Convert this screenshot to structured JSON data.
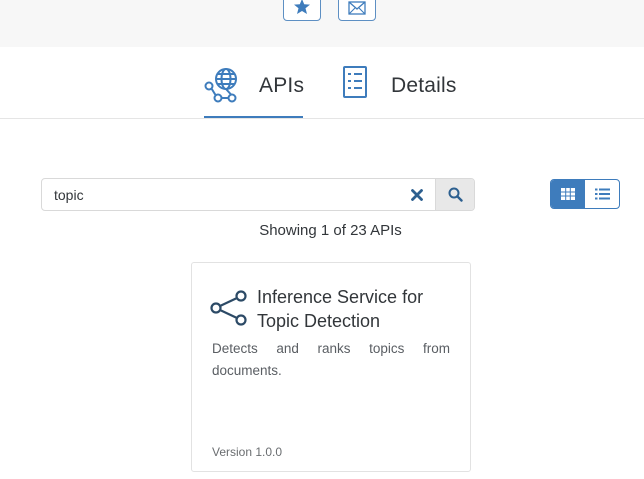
{
  "top_bar": {
    "favorite_icon": "star-icon",
    "mail_icon": "envelope-icon"
  },
  "tabs": [
    {
      "label": "APIs",
      "icon": "globe-network-icon",
      "active": true
    },
    {
      "label": "Details",
      "icon": "document-list-icon",
      "active": false
    }
  ],
  "search": {
    "value": "topic",
    "placeholder": "",
    "clear_icon": "close-icon",
    "search_icon": "search-icon"
  },
  "view_toggle": {
    "options": [
      "grid-view-icon",
      "list-view-icon"
    ],
    "active": "grid-view-icon"
  },
  "results": {
    "summary": "Showing 1 of 23 APIs"
  },
  "cards": [
    {
      "icon": "share-icon",
      "title": "Inference Service for Topic Detection",
      "description": "Detects and ranks topics from documents.",
      "version": "Version 1.0.0"
    }
  ],
  "colors": {
    "accent": "#3e7cbc",
    "text": "#32363a",
    "border": "#d9d9d9",
    "band": "#f7f7f7"
  }
}
